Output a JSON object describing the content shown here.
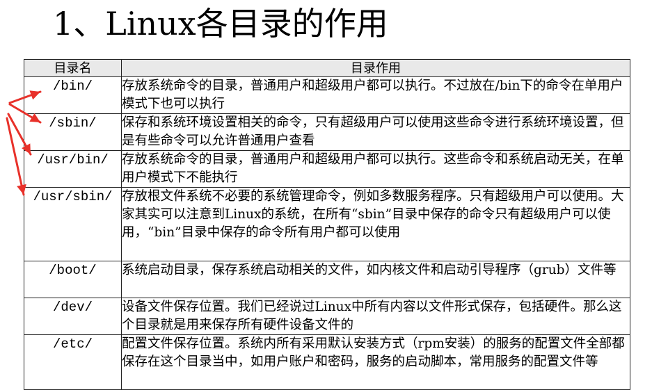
{
  "title": "1、Linux各目录的作用",
  "table": {
    "headers": [
      "目录名",
      "目录作用"
    ],
    "rows": [
      {
        "dir": "/bin/",
        "desc": "存放系统命令的目录，普通用户和超级用户都可以执行。不过放在/bin下的命令在单用户模式下也可以执行"
      },
      {
        "dir": "/sbin/",
        "desc": "保存和系统环境设置相关的命令，只有超级用户可以使用这些命令进行系统环境设置，但是有些命令可以允许普通用户查看"
      },
      {
        "dir": "/usr/bin/",
        "desc": "存放系统命令的目录，普通用户和超级用户都可以执行。这些命令和系统启动无关，在单用户模式下不能执行"
      },
      {
        "dir": "/usr/sbin/",
        "desc": "存放根文件系统不必要的系统管理命令，例如多数服务程序。只有超级用户可以使用。大家其实可以注意到Linux的系统，在所有“sbin”目录中保存的命令只有超级用户可以使用，“bin”目录中保存的命令所有用户都可以使用"
      },
      {
        "dir": "/boot/",
        "desc": "系统启动目录，保存系统启动相关的文件，如内核文件和启动引导程序（grub）文件等"
      },
      {
        "dir": "/dev/",
        "desc": "设备文件保存位置。我们已经说过Linux中所有内容以文件形式保存，包括硬件。那么这个目录就是用来保存所有硬件设备文件的"
      },
      {
        "dir": "/etc/",
        "desc": "配置文件保存位置。系统内所有采用默认安装方式（rpm安装）的服务的配置文件全部都保存在这个目录当中，如用户账户和密码，服务的启动脚本，常用服务的配置文件等"
      }
    ]
  },
  "annotation_color": "#e8312a"
}
